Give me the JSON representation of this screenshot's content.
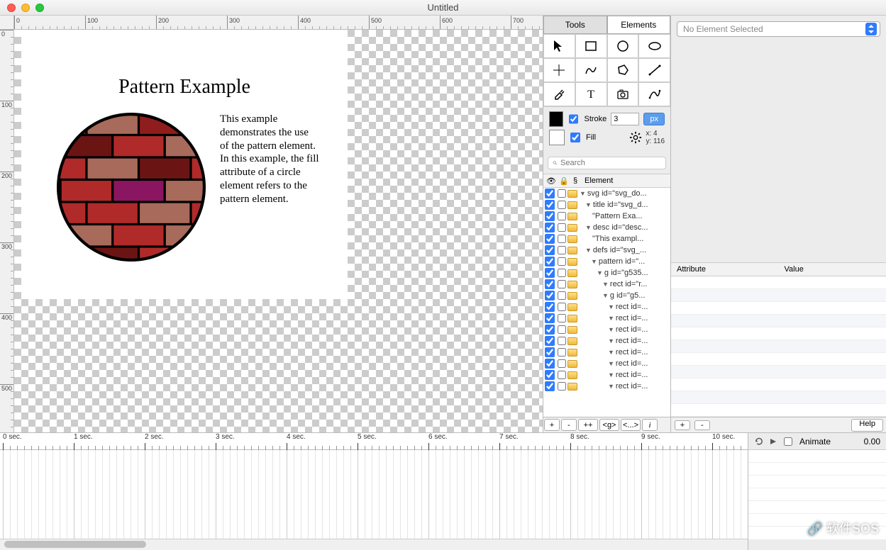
{
  "window": {
    "title": "Untitled"
  },
  "tabs": {
    "tools": "Tools",
    "elements": "Elements"
  },
  "ruler_marks": [
    "0",
    "100",
    "200",
    "300",
    "400",
    "500",
    "600",
    "700"
  ],
  "ruler_marks_v": [
    "0",
    "100",
    "200",
    "300",
    "400",
    "500"
  ],
  "artboard": {
    "title": "Pattern Example",
    "description": "This example demonstrates the use of the pattern element. In this example, the fill attribute of a circle element refers to the pattern element."
  },
  "stroke_panel": {
    "stroke_label": "Stroke",
    "fill_label": "Fill",
    "stroke_value": "3",
    "unit": "px",
    "coord_x": "x: 4",
    "coord_y": "y: 116"
  },
  "search_placeholder": "Search",
  "tree_header": {
    "element": "Element"
  },
  "tree": [
    {
      "indent": 0,
      "label": "svg id=\"svg_do..."
    },
    {
      "indent": 1,
      "label": "title id=\"svg_d..."
    },
    {
      "indent": 2,
      "label": "\"Pattern Exa...",
      "leaf": true
    },
    {
      "indent": 1,
      "label": "desc id=\"desc..."
    },
    {
      "indent": 2,
      "label": "\"This exampl...",
      "leaf": true
    },
    {
      "indent": 1,
      "label": "defs id=\"svg_..."
    },
    {
      "indent": 2,
      "label": "pattern id=\"..."
    },
    {
      "indent": 3,
      "label": "g id=\"g535..."
    },
    {
      "indent": 4,
      "label": "rect id=\"r..."
    },
    {
      "indent": 4,
      "label": "g id=\"g5..."
    },
    {
      "indent": 5,
      "label": "rect id=..."
    },
    {
      "indent": 5,
      "label": "rect id=..."
    },
    {
      "indent": 5,
      "label": "rect id=..."
    },
    {
      "indent": 5,
      "label": "rect id=..."
    },
    {
      "indent": 5,
      "label": "rect id=..."
    },
    {
      "indent": 5,
      "label": "rect id=..."
    },
    {
      "indent": 5,
      "label": "rect id=..."
    },
    {
      "indent": 5,
      "label": "rect id=..."
    }
  ],
  "tree_buttons": [
    "+",
    "-",
    "++",
    "<g>",
    "<...>",
    "i"
  ],
  "inspector": {
    "selector_text": "No Element Selected",
    "attribute": "Attribute",
    "value": "Value",
    "buttons": [
      "+",
      "-"
    ],
    "help": "Help"
  },
  "timeline": {
    "labels": [
      "0 sec.",
      "1 sec.",
      "2 sec.",
      "3 sec.",
      "4 sec.",
      "5 sec.",
      "6 sec.",
      "7 sec.",
      "8 sec.",
      "9 sec.",
      "10 sec."
    ],
    "animate_label": "Animate",
    "time_value": "0.00"
  },
  "watermark": "软件SOS"
}
